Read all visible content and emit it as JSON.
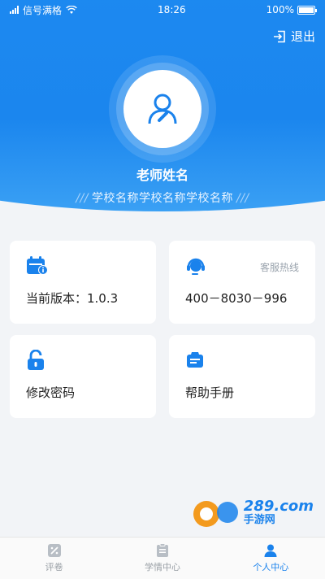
{
  "status_bar": {
    "carrier": "信号满格",
    "time": "18:26",
    "battery": "100%"
  },
  "header": {
    "logout_label": "退出",
    "teacher_name": "老师姓名",
    "school_name": "学校名称学校名称学校名称",
    "slash_left": "///",
    "slash_right": "///"
  },
  "cards": {
    "version": {
      "label": "当前版本：1.0.3",
      "icon": "calendar-info-icon"
    },
    "hotline": {
      "title": "客服热线",
      "phone": "400－8030－996",
      "icon": "headset-icon"
    },
    "password": {
      "label": "修改密码",
      "icon": "lock-icon"
    },
    "help": {
      "label": "帮助手册",
      "icon": "manual-icon"
    }
  },
  "bottom_nav": {
    "items": [
      {
        "label": "评卷",
        "icon": "grading-icon",
        "active": false
      },
      {
        "label": "学情中心",
        "icon": "clipboard-icon",
        "active": false
      },
      {
        "label": "个人中心",
        "icon": "person-icon",
        "active": true
      }
    ]
  },
  "watermark": {
    "brand": "289.com",
    "sub": "手游网"
  },
  "colors": {
    "primary": "#1a82ec",
    "watermark_orange": "#f39a1e",
    "background": "#f2f4f7"
  }
}
